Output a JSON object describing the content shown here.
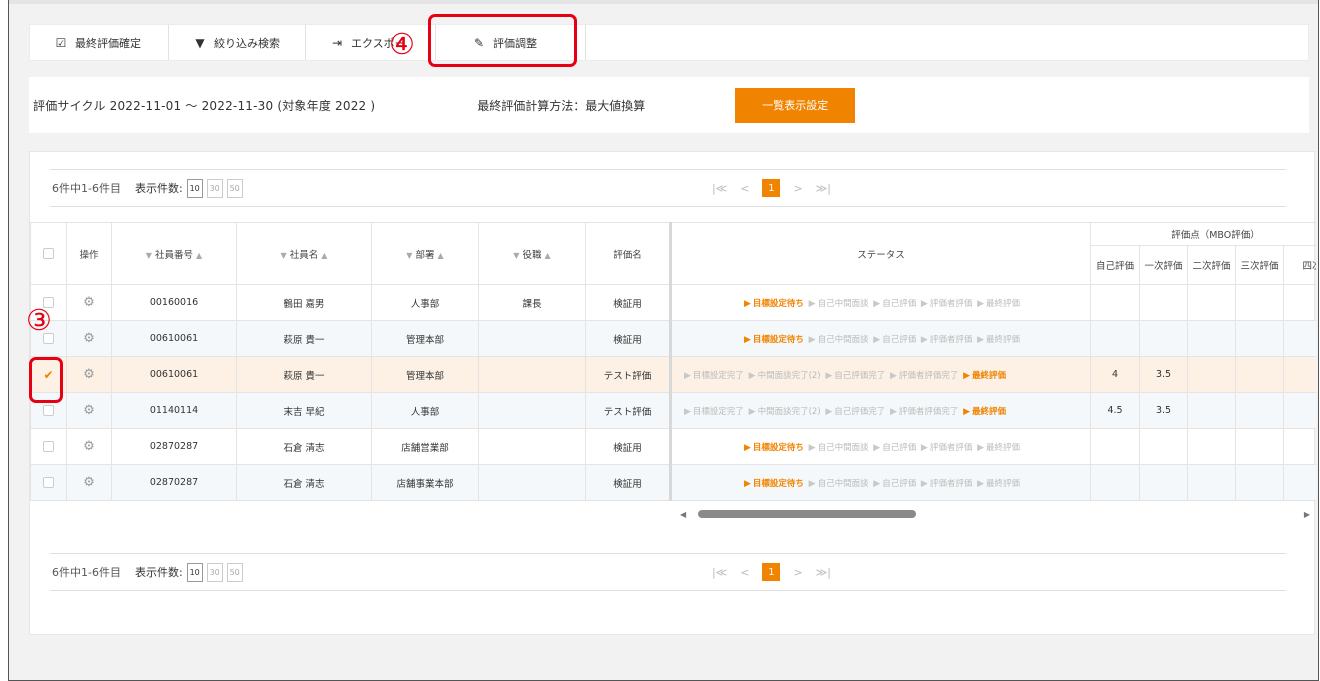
{
  "toolbar": {
    "finalize_label": "最終評価確定",
    "filter_label": "絞り込み検索",
    "export_label": "エクスポー",
    "adjust_label": "評価調整"
  },
  "cycle": {
    "range_text": "評価サイクル 2022-11-01 ～ 2022-11-30 (対象年度 2022 )",
    "calc_text": "最終評価計算方法：最大値換算",
    "display_settings_label": "一覧表示設定"
  },
  "pager": {
    "count_text": "6件中1-6件目",
    "perpage_label": "表示件数:",
    "perpage_options": [
      "10",
      "30",
      "50"
    ],
    "first": "|≪",
    "prev": "<",
    "current_page": "1",
    "next": ">",
    "last": "≫|"
  },
  "table": {
    "headers": {
      "action": "操作",
      "emp_no": "社員番号",
      "emp_name": "社員名",
      "dept": "部署",
      "position": "役職",
      "eval_name": "評価名",
      "status": "ステータス",
      "score_group": "評価点（MBO評価）",
      "self": "自己評価",
      "first": "一次評価",
      "second": "二次評価",
      "third": "三次評価",
      "fourth": "四次"
    },
    "sort_down": "▼",
    "sort_up": "▲",
    "rows": [
      {
        "emp_no": "00160016",
        "name": "鶴田 嘉男",
        "dept": "人事部",
        "position": "課長",
        "eval": "検証用",
        "steps": [
          "目標設定待ち",
          "自己中間面談",
          "自己評価",
          "評価者評価",
          "最終評価"
        ],
        "active": 0,
        "self": "",
        "first": ""
      },
      {
        "emp_no": "00610061",
        "name": "萩原 貴一",
        "dept": "管理本部",
        "position": "",
        "eval": "検証用",
        "steps": [
          "目標設定待ち",
          "自己中間面談",
          "自己評価",
          "評価者評価",
          "最終評価"
        ],
        "active": 0,
        "self": "",
        "first": ""
      },
      {
        "emp_no": "00610061",
        "name": "萩原 貴一",
        "dept": "管理本部",
        "position": "",
        "eval": "テスト評価",
        "steps": [
          "目標設定完了",
          "中間面談完了(2)",
          "自己評価完了",
          "評価者評価完了",
          "最終評価"
        ],
        "active": 4,
        "self": "4",
        "first": "3.5"
      },
      {
        "emp_no": "01140114",
        "name": "末吉 早紀",
        "dept": "人事部",
        "position": "",
        "eval": "テスト評価",
        "steps": [
          "目標設定完了",
          "中間面談完了(2)",
          "自己評価完了",
          "評価者評価完了",
          "最終評価"
        ],
        "active": 4,
        "self": "4.5",
        "first": "3.5"
      },
      {
        "emp_no": "02870287",
        "name": "石倉 清志",
        "dept": "店舗営業部",
        "position": "",
        "eval": "検証用",
        "steps": [
          "目標設定待ち",
          "自己中間面談",
          "自己評価",
          "評価者評価",
          "最終評価"
        ],
        "active": 0,
        "self": "",
        "first": ""
      },
      {
        "emp_no": "02870287",
        "name": "石倉 清志",
        "dept": "店舗事業本部",
        "position": "",
        "eval": "検証用",
        "steps": [
          "目標設定待ち",
          "自己中間面談",
          "自己評価",
          "評価者評価",
          "最終評価"
        ],
        "active": 0,
        "self": "",
        "first": ""
      }
    ]
  },
  "annotations": {
    "step3": "③",
    "step4": "④",
    "highlight_color": "#e60012"
  },
  "colors": {
    "accent": "#f08300"
  }
}
